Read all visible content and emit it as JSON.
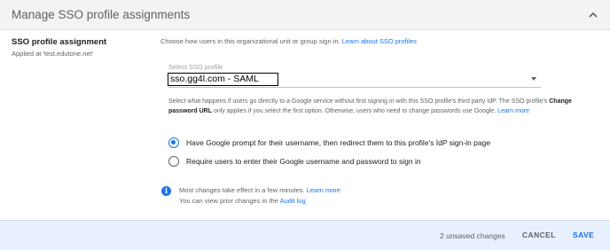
{
  "header": {
    "title": "Manage SSO profile assignments",
    "collapse_icon": "chevron-up-icon"
  },
  "left": {
    "title": "SSO profile assignment",
    "subtitle": "Applied at 'test.edutone.net'"
  },
  "main": {
    "description": "Choose how users in this organizational unit or group sign in.",
    "description_link": "Learn about SSO profiles",
    "select": {
      "label": "Select SSO profile",
      "value": "sso.gg4l.com - SAML"
    },
    "info": {
      "part1": "Select what happens if users go directly to a Google service without first signing in with this SSO profile's third party IdP. The SSO profile's",
      "bold": "Change password URL",
      "part2": "only applies if you select the first option. Otherwise, users who need to change passwords use Google.",
      "link": "Learn more"
    },
    "options": [
      {
        "label": "Have Google prompt for their username, then redirect them to this profile's IdP sign-in page",
        "selected": true
      },
      {
        "label": "Require users to enter their Google username and password to sign in",
        "selected": false
      }
    ],
    "note": {
      "icon": "info-icon",
      "line1": "Most changes take effect in a few minutes.",
      "line1_link": "Learn more",
      "line2": "You can view prior changes in the",
      "line2_link": "Audit log"
    }
  },
  "footer": {
    "unsaved": "2 unsaved changes",
    "cancel_label": "CANCEL",
    "save_label": "SAVE"
  },
  "colors": {
    "accent": "#1a73e8",
    "footer_bg": "#e8f0fe",
    "header_bg": "#f1f3f4"
  }
}
